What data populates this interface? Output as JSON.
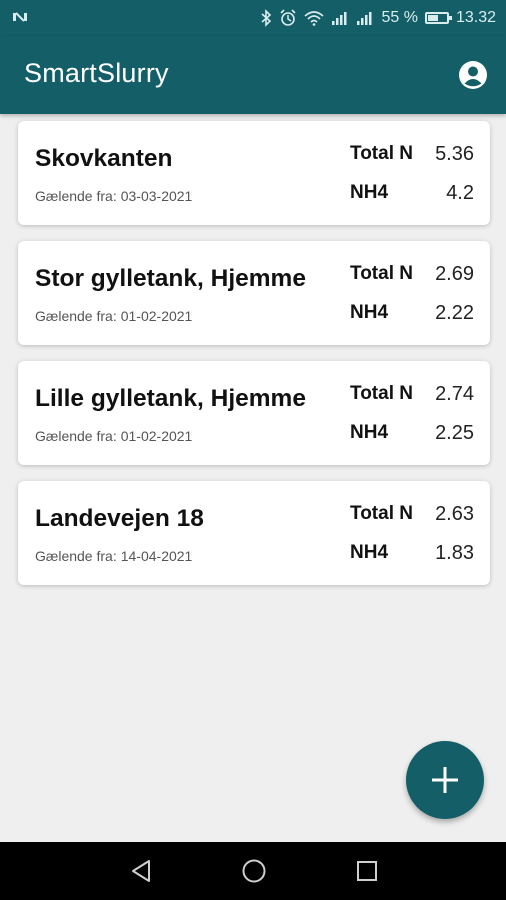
{
  "status_bar": {
    "battery_percent_text": "55 %",
    "battery_level": 0.55,
    "time": "13.32",
    "icons": [
      "nfc-icon",
      "bluetooth-icon",
      "alarm-icon",
      "wifi-icon",
      "signal-icon",
      "signal-icon",
      "battery-icon"
    ]
  },
  "app_bar": {
    "title": "SmartSlurry",
    "action_icon": "account-circle-icon"
  },
  "tanks": [
    {
      "name": "Skovkanten",
      "date_label": "Gælende fra:",
      "date": "03-03-2021",
      "total_n_label": "Total N",
      "total_n": "5.36",
      "nh4_label": "NH4",
      "nh4": "4.2"
    },
    {
      "name": "Stor gylletank, Hjemme",
      "date_label": "Gælende fra:",
      "date": "01-02-2021",
      "total_n_label": "Total N",
      "total_n": "2.69",
      "nh4_label": "NH4",
      "nh4": "2.22"
    },
    {
      "name": "Lille gylletank, Hjemme",
      "date_label": "Gælende fra:",
      "date": "01-02-2021",
      "total_n_label": "Total N",
      "total_n": "2.74",
      "nh4_label": "NH4",
      "nh4": "2.25"
    },
    {
      "name": "Landevejen 18",
      "date_label": "Gælende fra:",
      "date": "14-04-2021",
      "total_n_label": "Total N",
      "total_n": "2.63",
      "nh4_label": "NH4",
      "nh4": "1.83"
    }
  ],
  "fab": {
    "icon": "plus-icon"
  },
  "nav_bar": {
    "icons": [
      "back-icon",
      "home-icon",
      "recents-icon"
    ]
  },
  "colors": {
    "primary": "#145f67",
    "background": "#efefef",
    "card": "#ffffff"
  }
}
